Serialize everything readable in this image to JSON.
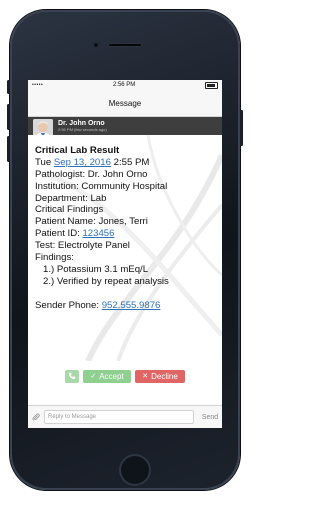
{
  "status_bar": {
    "signal": "•••••",
    "time": "2:56 PM"
  },
  "nav": {
    "title": "Message"
  },
  "sender": {
    "name": "Dr. John Orno",
    "time": "2:56 PM (few seconds ago)"
  },
  "message": {
    "title": "Critical Lab Result",
    "date_prefix": "Tue ",
    "date_link": "Sep 13, 2016",
    "date_suffix": " 2:55 PM",
    "pathologist": "Pathologist: Dr. John Orno",
    "institution": "Institution: Community Hospital",
    "department": "Department: Lab",
    "category": "Critical Findings",
    "patient_name": "Patient Name: Jones, Terri",
    "patient_id_label": "Patient ID: ",
    "patient_id": "123456",
    "test": "Test: Electrolyte Panel",
    "findings_label": "Findings:",
    "findings": [
      "1.) Potassium 3.1 mEq/L",
      "2.) Verified by repeat analysis"
    ],
    "phone_label": "Sender Phone: ",
    "phone": "952.555.9876"
  },
  "actions": {
    "call_icon": "phone-icon",
    "accept_label": "Accept",
    "decline_label": "Decline"
  },
  "reply": {
    "placeholder": "Reply to Message",
    "send_label": "Send"
  },
  "colors": {
    "accept": "#8fcf8f",
    "decline": "#e06666",
    "link": "#2d6fb8",
    "sender_bar": "#3e3e3e"
  }
}
